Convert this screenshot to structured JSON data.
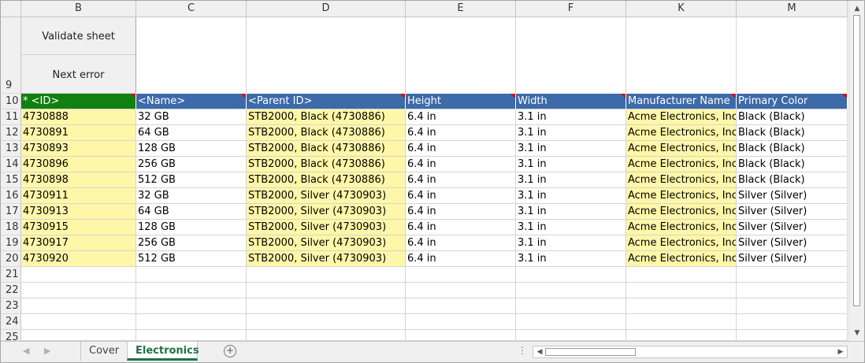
{
  "columns": [
    "B",
    "C",
    "D",
    "E",
    "F",
    "K",
    "M"
  ],
  "buttons": {
    "validate": "Validate sheet",
    "next_error": "Next error"
  },
  "row_numbers": [
    "9",
    "10",
    "11",
    "12",
    "13",
    "14",
    "15",
    "16",
    "17",
    "18",
    "19",
    "20",
    "21",
    "22",
    "23",
    "24",
    "25"
  ],
  "header": [
    "* <ID>",
    "<Name>",
    "<Parent ID>",
    "Height",
    "Width",
    "Manufacturer Name",
    "Primary Color"
  ],
  "rows": [
    [
      "4730888",
      "32 GB",
      "STB2000, Black (4730886)",
      "6.4 in",
      "3.1 in",
      "Acme Electronics, Inc.",
      "Black (Black)"
    ],
    [
      "4730891",
      "64 GB",
      "STB2000, Black (4730886)",
      "6.4 in",
      "3.1 in",
      "Acme Electronics, Inc.",
      "Black (Black)"
    ],
    [
      "4730893",
      "128 GB",
      "STB2000, Black (4730886)",
      "6.4 in",
      "3.1 in",
      "Acme Electronics, Inc.",
      "Black (Black)"
    ],
    [
      "4730896",
      "256 GB",
      "STB2000, Black (4730886)",
      "6.4 in",
      "3.1 in",
      "Acme Electronics, Inc.",
      "Black (Black)"
    ],
    [
      "4730898",
      "512 GB",
      "STB2000, Black (4730886)",
      "6.4 in",
      "3.1 in",
      "Acme Electronics, Inc.",
      "Black (Black)"
    ],
    [
      "4730911",
      "32 GB",
      "STB2000, Silver (4730903)",
      "6.4 in",
      "3.1 in",
      "Acme Electronics, Inc.",
      "Silver (Silver)"
    ],
    [
      "4730913",
      "64 GB",
      "STB2000, Silver (4730903)",
      "6.4 in",
      "3.1 in",
      "Acme Electronics, Inc.",
      "Silver (Silver)"
    ],
    [
      "4730915",
      "128 GB",
      "STB2000, Silver (4730903)",
      "6.4 in",
      "3.1 in",
      "Acme Electronics, Inc.",
      "Silver (Silver)"
    ],
    [
      "4730917",
      "256 GB",
      "STB2000, Silver (4730903)",
      "6.4 in",
      "3.1 in",
      "Acme Electronics, Inc.",
      "Silver (Silver)"
    ],
    [
      "4730920",
      "512 GB",
      "STB2000, Silver (4730903)",
      "6.4 in",
      "3.1 in",
      "Acme Electronics, Inc.",
      "Silver (Silver)"
    ]
  ],
  "yellow_columns": [
    "B",
    "D",
    "K"
  ],
  "colors": {
    "header_blue": "#3d6aa8",
    "id_header_green": "#108010",
    "required_yellow": "#fff7a8",
    "active_tab_green": "#1e7145"
  },
  "tabs": [
    {
      "label": "Cover",
      "active": false
    },
    {
      "label": "Electronics",
      "active": true
    }
  ],
  "icons": {
    "add_sheet": "plus-circle-icon",
    "scroll_up": "arrow-up-icon",
    "scroll_down": "arrow-down-icon",
    "scroll_left": "arrow-left-icon",
    "scroll_right": "arrow-right-icon"
  }
}
